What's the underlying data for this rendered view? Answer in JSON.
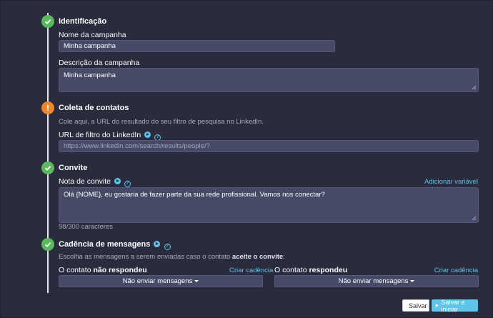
{
  "identificacao": {
    "heading": "Identificação",
    "name_label": "Nome da campanha",
    "name_value": "Minha campanha",
    "desc_label": "Descrição da campanha",
    "desc_value": "Minha campanha"
  },
  "coleta": {
    "heading": "Coleta de contatos",
    "hint": "Cole aqui, a URL do resultado do seu filtro de pesquisa no LinkedIn.",
    "url_label": "URL de filtro do LinkedIn",
    "url_placeholder": "https://www.linkedin.com/search/results/people/?"
  },
  "convite": {
    "heading": "Convite",
    "note_label": "Nota de convite",
    "add_variable": "Adicionar variável",
    "note_value": "Olá {NOME}, eu gostaria de fazer parte da sua rede profissional. Vamos nos conectar?",
    "char_count": "98/300 caracteres"
  },
  "cadencia": {
    "heading": "Cadência de mensagens",
    "hint_prefix": "Escolha as mensagens a serem enviadas caso o contato",
    "hint_bold": "aceite o convite",
    "hint_suffix": ":",
    "no_reply": {
      "prefix": "O contato",
      "bold": "não respondeu",
      "link": "Criar cadência",
      "dropdown": "Não enviar mensagens"
    },
    "replied": {
      "prefix": "O contato",
      "bold": "respondeu",
      "link": "Criar cadência",
      "dropdown": "Não enviar mensagens"
    }
  },
  "actions": {
    "save": "Salvar",
    "save_start": "Salvar e iniciar"
  },
  "colors": {
    "success": "#5cb85c",
    "warning": "#f0852b",
    "accent": "#5fc4e8",
    "background": "#2a2b3d"
  },
  "icons": [
    "check-icon",
    "exclamation-icon",
    "play-icon",
    "help-icon",
    "caret-down-icon",
    "floppy-icon"
  ]
}
